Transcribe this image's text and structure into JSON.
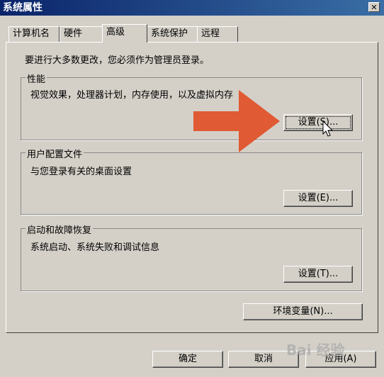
{
  "window": {
    "title": "系统属性",
    "close_icon": "close-icon"
  },
  "tabs": [
    {
      "label": "计算机名",
      "active": false
    },
    {
      "label": "硬件",
      "active": false
    },
    {
      "label": "高级",
      "active": true
    },
    {
      "label": "系统保护",
      "active": false
    },
    {
      "label": "远程",
      "active": false
    }
  ],
  "notice": "要进行大多数更改，您必须作为管理员登录。",
  "performance": {
    "title": "性能",
    "description": "视觉效果，处理器计划，内存使用，以及虚拟内存",
    "button": "设置(S)..."
  },
  "user_profiles": {
    "title": "用户配置文件",
    "description": "与您登录有关的桌面设置",
    "button": "设置(E)..."
  },
  "startup_recovery": {
    "title": "启动和故障恢复",
    "description": "系统启动、系统失败和调试信息",
    "button": "设置(T)..."
  },
  "env_button": "环境变量(N)...",
  "footer": {
    "ok": "确定",
    "cancel": "取消",
    "apply": "应用(A)"
  },
  "overlay": {
    "arrow_color": "#e05a33",
    "watermark": "Bai 经验"
  }
}
